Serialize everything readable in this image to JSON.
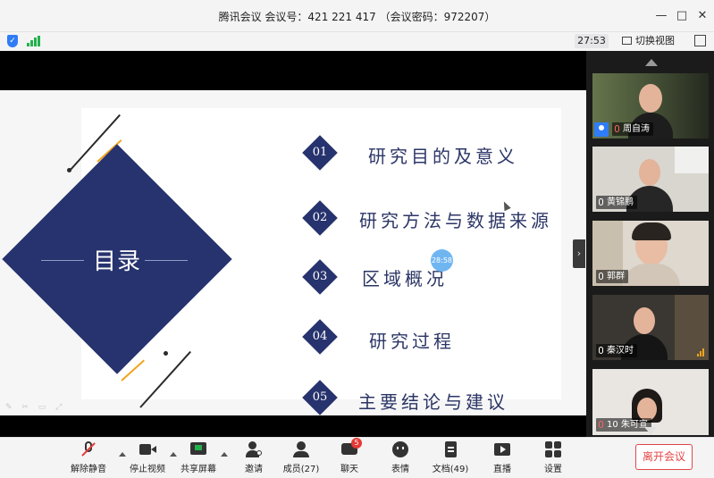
{
  "window": {
    "title": "腾讯会议 会议号：421 221 417 （会议密码：972207）",
    "minimize": "—",
    "maximize": "□",
    "close": "✕"
  },
  "status": {
    "elapsed": "27:53",
    "switch_view_label": "切换视图"
  },
  "slide": {
    "heading": "目录",
    "items": [
      {
        "num": "01",
        "text": "研究目的及意义"
      },
      {
        "num": "02",
        "text": "研究方法与数据来源"
      },
      {
        "num": "03",
        "text": "区域概况"
      },
      {
        "num": "04",
        "text": "研究过程"
      },
      {
        "num": "05",
        "text": "主要结论与建议"
      }
    ],
    "overlay_time": "28:58",
    "accent_color": "#27336e"
  },
  "participants": [
    {
      "name": "周自涛"
    },
    {
      "name": "黄锦鹏"
    },
    {
      "name": "郭群"
    },
    {
      "name": "秦汉时"
    },
    {
      "name": "10 朱可宣"
    }
  ],
  "toolbar": {
    "unmute": "解除静音",
    "stop_video": "停止视频",
    "share_screen": "共享屏幕",
    "invite": "邀请",
    "members": "成员(27)",
    "chat": "聊天",
    "chat_badge": "5",
    "reactions": "表情",
    "docs": "文档(49)",
    "live": "直播",
    "settings": "设置",
    "leave": "离开会议"
  }
}
